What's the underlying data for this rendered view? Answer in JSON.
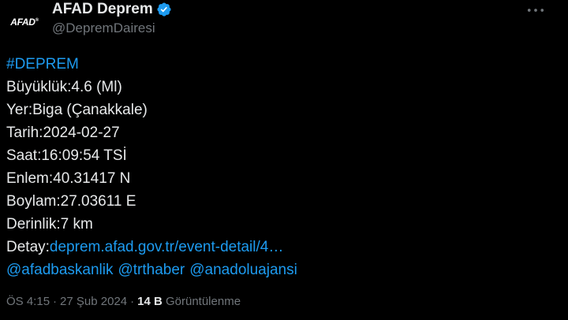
{
  "author": {
    "avatar_text": "AFAD",
    "avatar_mark": "®",
    "display_name": "AFAD Deprem",
    "handle": "@DepremDairesi",
    "verified_color": "#1d9bf0"
  },
  "tweet": {
    "hashtag": "#DEPREM",
    "lines": [
      "Büyüklük:4.6 (Ml)",
      "Yer:Biga (Çanakkale)",
      "Tarih:2024-02-27",
      "Saat:16:09:54 TSİ",
      "Enlem:40.31417 N",
      "Boylam:27.03611 E",
      "Derinlik:7 km"
    ],
    "detail_label": "Detay:",
    "detail_link": "deprem.afad.gov.tr/event-detail/4…",
    "mentions": [
      "@afadbaskanlik",
      "@trthaber",
      "@anadoluajansi"
    ]
  },
  "meta": {
    "time": "ÖS 4:15",
    "separator": "·",
    "date": "27 Şub 2024",
    "views_count": "14 B",
    "views_label": "Görüntülenme"
  },
  "colors": {
    "background": "#000000",
    "text": "#e7e9ea",
    "secondary": "#71767b",
    "link": "#1d9bf0"
  },
  "icons": {
    "verified": "verified-badge-icon",
    "more": "more-horizontal-icon"
  }
}
